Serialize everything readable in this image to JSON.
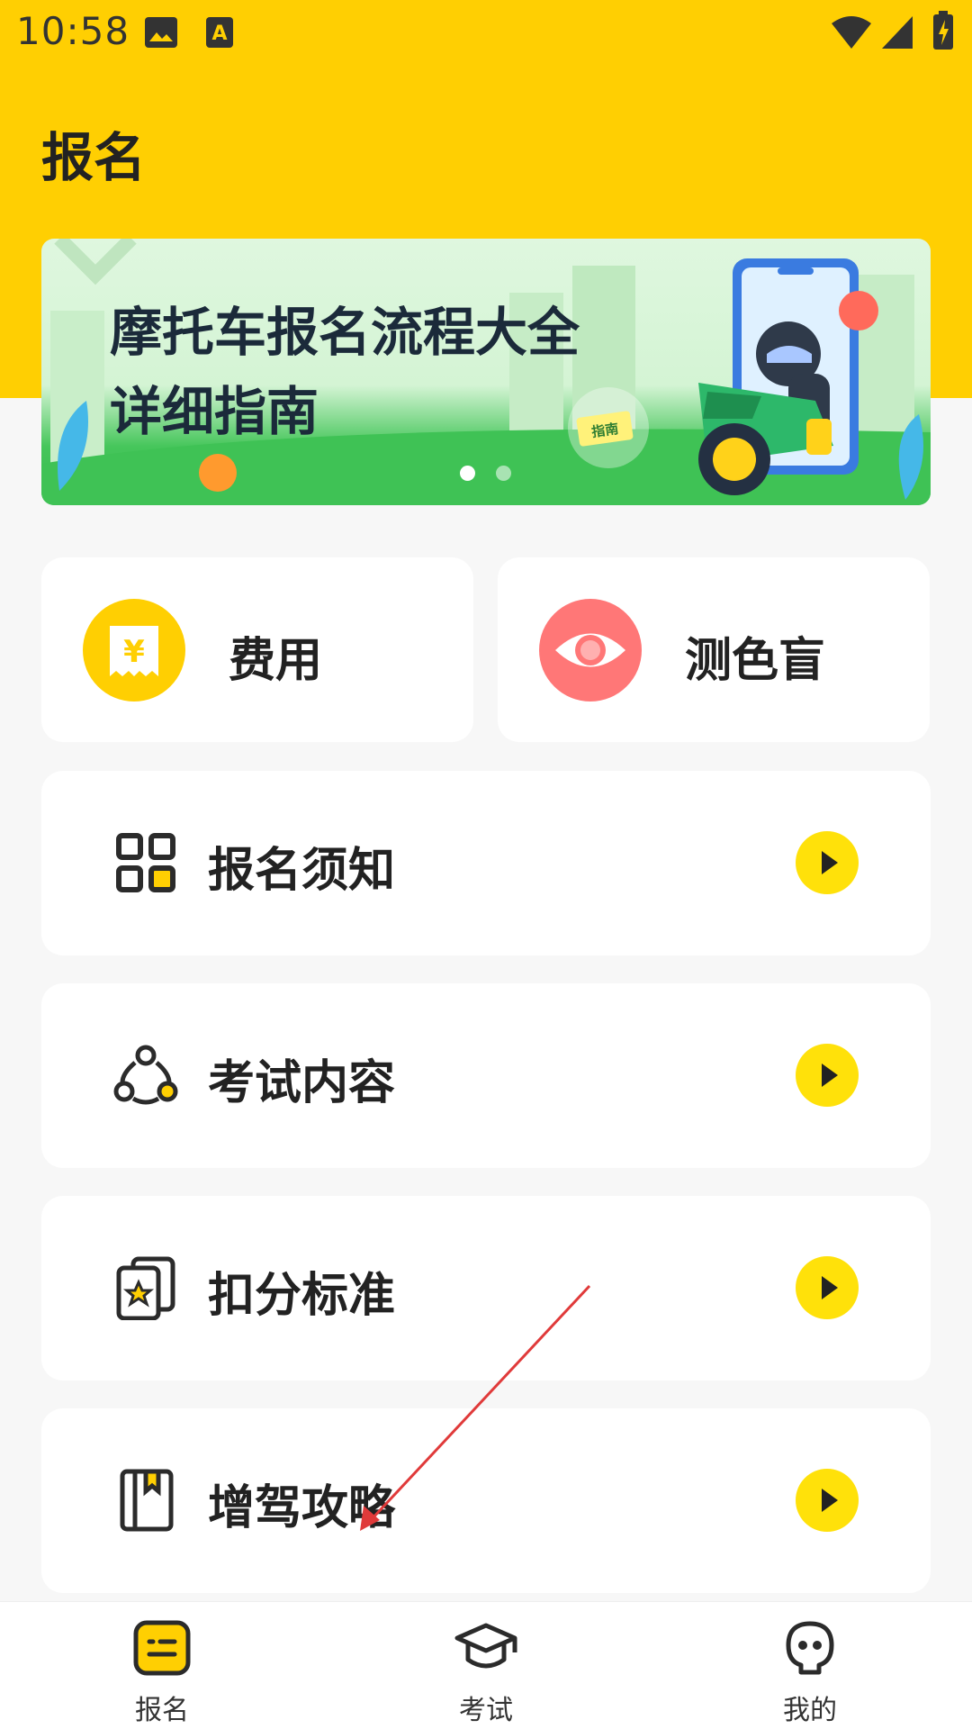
{
  "status_bar": {
    "time": "10:58",
    "icons": [
      "image-icon",
      "font-icon",
      "wifi-icon",
      "signal-icon",
      "battery-icon"
    ]
  },
  "header": {
    "title": "报名"
  },
  "banner": {
    "title_line1": "摩托车报名流程大全",
    "title_line2": "详细指南",
    "tag": "指南",
    "page_count": 2,
    "active_page": 1
  },
  "quick_actions": [
    {
      "label": "费用",
      "icon": "yuan-receipt-icon",
      "color": "#ffcf02"
    },
    {
      "label": "测色盲",
      "icon": "eye-icon",
      "color": "#ff7777"
    }
  ],
  "list_items": [
    {
      "label": "报名须知",
      "icon": "grid-icon"
    },
    {
      "label": "考试内容",
      "icon": "nodes-icon"
    },
    {
      "label": "扣分标准",
      "icon": "star-cards-icon"
    },
    {
      "label": "增驾攻略",
      "icon": "book-icon"
    }
  ],
  "bottom_nav": [
    {
      "label": "报名",
      "icon": "list-doc-icon",
      "active": true
    },
    {
      "label": "考试",
      "icon": "graduation-cap-icon",
      "active": false
    },
    {
      "label": "我的",
      "icon": "person-head-icon",
      "active": false
    }
  ],
  "colors": {
    "brand_yellow": "#ffcf02",
    "arrow_yellow": "#ffe10a",
    "eye_red": "#ff7777",
    "annotation_red": "#e03a3a"
  }
}
